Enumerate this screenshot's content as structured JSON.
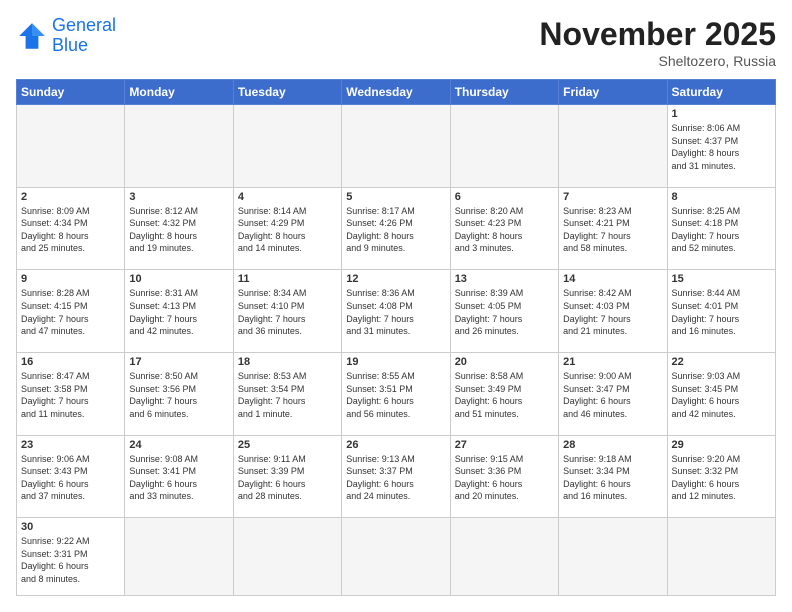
{
  "logo": {
    "line1": "General",
    "line2": "Blue"
  },
  "title": "November 2025",
  "subtitle": "Sheltozero, Russia",
  "days": [
    "Sunday",
    "Monday",
    "Tuesday",
    "Wednesday",
    "Thursday",
    "Friday",
    "Saturday"
  ],
  "weeks": [
    [
      {
        "day": "",
        "empty": true
      },
      {
        "day": "",
        "empty": true
      },
      {
        "day": "",
        "empty": true
      },
      {
        "day": "",
        "empty": true
      },
      {
        "day": "",
        "empty": true
      },
      {
        "day": "",
        "empty": true
      },
      {
        "day": "1",
        "text": "Sunrise: 8:06 AM\nSunset: 4:37 PM\nDaylight: 8 hours\nand 31 minutes."
      }
    ],
    [
      {
        "day": "2",
        "text": "Sunrise: 8:09 AM\nSunset: 4:34 PM\nDaylight: 8 hours\nand 25 minutes."
      },
      {
        "day": "3",
        "text": "Sunrise: 8:12 AM\nSunset: 4:32 PM\nDaylight: 8 hours\nand 19 minutes."
      },
      {
        "day": "4",
        "text": "Sunrise: 8:14 AM\nSunset: 4:29 PM\nDaylight: 8 hours\nand 14 minutes."
      },
      {
        "day": "5",
        "text": "Sunrise: 8:17 AM\nSunset: 4:26 PM\nDaylight: 8 hours\nand 9 minutes."
      },
      {
        "day": "6",
        "text": "Sunrise: 8:20 AM\nSunset: 4:23 PM\nDaylight: 8 hours\nand 3 minutes."
      },
      {
        "day": "7",
        "text": "Sunrise: 8:23 AM\nSunset: 4:21 PM\nDaylight: 7 hours\nand 58 minutes."
      },
      {
        "day": "8",
        "text": "Sunrise: 8:25 AM\nSunset: 4:18 PM\nDaylight: 7 hours\nand 52 minutes."
      }
    ],
    [
      {
        "day": "9",
        "text": "Sunrise: 8:28 AM\nSunset: 4:15 PM\nDaylight: 7 hours\nand 47 minutes."
      },
      {
        "day": "10",
        "text": "Sunrise: 8:31 AM\nSunset: 4:13 PM\nDaylight: 7 hours\nand 42 minutes."
      },
      {
        "day": "11",
        "text": "Sunrise: 8:34 AM\nSunset: 4:10 PM\nDaylight: 7 hours\nand 36 minutes."
      },
      {
        "day": "12",
        "text": "Sunrise: 8:36 AM\nSunset: 4:08 PM\nDaylight: 7 hours\nand 31 minutes."
      },
      {
        "day": "13",
        "text": "Sunrise: 8:39 AM\nSunset: 4:05 PM\nDaylight: 7 hours\nand 26 minutes."
      },
      {
        "day": "14",
        "text": "Sunrise: 8:42 AM\nSunset: 4:03 PM\nDaylight: 7 hours\nand 21 minutes."
      },
      {
        "day": "15",
        "text": "Sunrise: 8:44 AM\nSunset: 4:01 PM\nDaylight: 7 hours\nand 16 minutes."
      }
    ],
    [
      {
        "day": "16",
        "text": "Sunrise: 8:47 AM\nSunset: 3:58 PM\nDaylight: 7 hours\nand 11 minutes."
      },
      {
        "day": "17",
        "text": "Sunrise: 8:50 AM\nSunset: 3:56 PM\nDaylight: 7 hours\nand 6 minutes."
      },
      {
        "day": "18",
        "text": "Sunrise: 8:53 AM\nSunset: 3:54 PM\nDaylight: 7 hours\nand 1 minute."
      },
      {
        "day": "19",
        "text": "Sunrise: 8:55 AM\nSunset: 3:51 PM\nDaylight: 6 hours\nand 56 minutes."
      },
      {
        "day": "20",
        "text": "Sunrise: 8:58 AM\nSunset: 3:49 PM\nDaylight: 6 hours\nand 51 minutes."
      },
      {
        "day": "21",
        "text": "Sunrise: 9:00 AM\nSunset: 3:47 PM\nDaylight: 6 hours\nand 46 minutes."
      },
      {
        "day": "22",
        "text": "Sunrise: 9:03 AM\nSunset: 3:45 PM\nDaylight: 6 hours\nand 42 minutes."
      }
    ],
    [
      {
        "day": "23",
        "text": "Sunrise: 9:06 AM\nSunset: 3:43 PM\nDaylight: 6 hours\nand 37 minutes."
      },
      {
        "day": "24",
        "text": "Sunrise: 9:08 AM\nSunset: 3:41 PM\nDaylight: 6 hours\nand 33 minutes."
      },
      {
        "day": "25",
        "text": "Sunrise: 9:11 AM\nSunset: 3:39 PM\nDaylight: 6 hours\nand 28 minutes."
      },
      {
        "day": "26",
        "text": "Sunrise: 9:13 AM\nSunset: 3:37 PM\nDaylight: 6 hours\nand 24 minutes."
      },
      {
        "day": "27",
        "text": "Sunrise: 9:15 AM\nSunset: 3:36 PM\nDaylight: 6 hours\nand 20 minutes."
      },
      {
        "day": "28",
        "text": "Sunrise: 9:18 AM\nSunset: 3:34 PM\nDaylight: 6 hours\nand 16 minutes."
      },
      {
        "day": "29",
        "text": "Sunrise: 9:20 AM\nSunset: 3:32 PM\nDaylight: 6 hours\nand 12 minutes."
      }
    ],
    [
      {
        "day": "30",
        "text": "Sunrise: 9:22 AM\nSunset: 3:31 PM\nDaylight: 6 hours\nand 8 minutes."
      },
      {
        "day": "",
        "empty": true
      },
      {
        "day": "",
        "empty": true
      },
      {
        "day": "",
        "empty": true
      },
      {
        "day": "",
        "empty": true
      },
      {
        "day": "",
        "empty": true
      },
      {
        "day": "",
        "empty": true
      }
    ]
  ]
}
